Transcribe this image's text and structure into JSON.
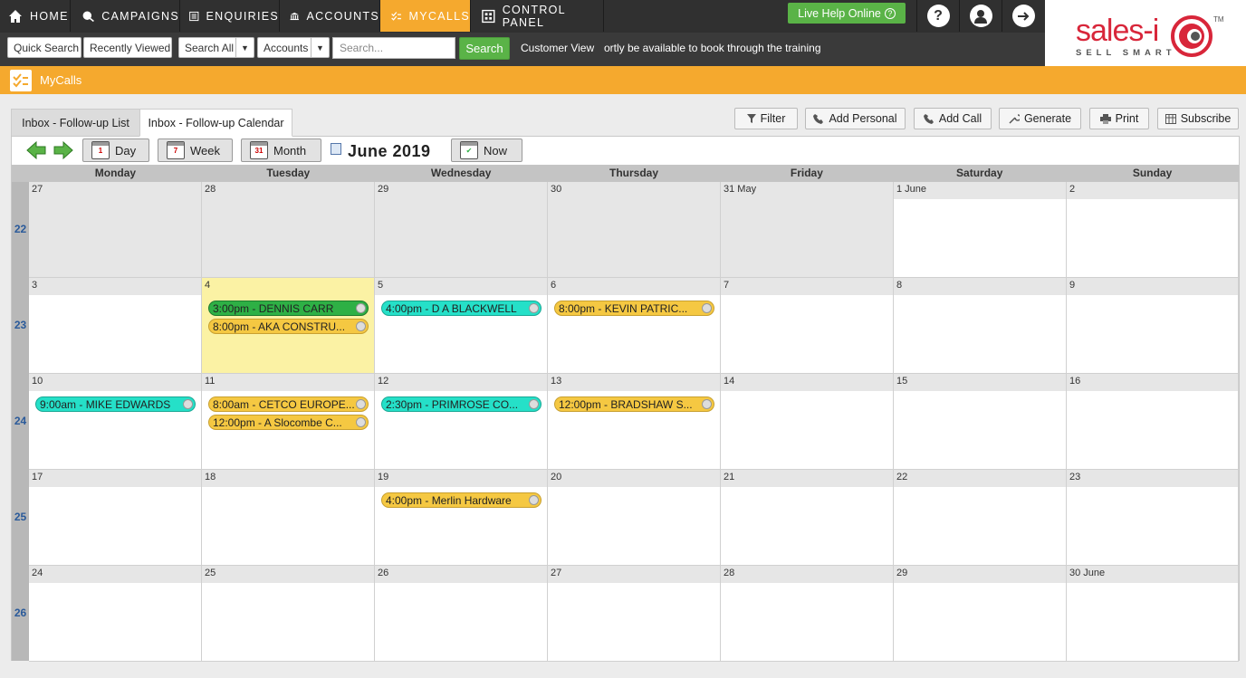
{
  "nav": {
    "items": [
      {
        "label": "HOME",
        "icon": "home-icon"
      },
      {
        "label": "CAMPAIGNS",
        "icon": "campaigns-icon"
      },
      {
        "label": "ENQUIRIES",
        "icon": "enquiries-icon"
      },
      {
        "label": "ACCOUNTS",
        "icon": "accounts-icon"
      },
      {
        "label": "MYCALLS",
        "icon": "mycalls-icon"
      },
      {
        "label": "CONTROL PANEL",
        "icon": "control-panel-icon"
      }
    ],
    "active": "MYCALLS",
    "live_help": "Live Help Online",
    "help_glyph": "?",
    "colors": {
      "bar": "#303030",
      "active": "#f5a92e",
      "live_help": "#5ab347"
    }
  },
  "subbar": {
    "quick_search": "Quick Search",
    "recently_viewed": "Recently Viewed",
    "search_all": "Search All",
    "accounts": "Accounts",
    "search_placeholder": "Search...",
    "search_button": "Search",
    "customer_view": "Customer View",
    "ticker": "ortly be available to book through the training t"
  },
  "logo": {
    "text": "sales-i",
    "tagline": "SELL SMART",
    "tm": "TM",
    "color": "#d8263a"
  },
  "page": {
    "title": "MyCalls"
  },
  "tabs": {
    "list": "Inbox - Follow-up List",
    "calendar": "Inbox - Follow-up Calendar"
  },
  "toolbar": {
    "filter": "Filter",
    "add_personal": "Add Personal",
    "add_call": "Add Call",
    "generate": "Generate",
    "print": "Print",
    "subscribe": "Subscribe"
  },
  "calendar": {
    "day": "Day",
    "week": "Week",
    "month": "Month",
    "now": "Now",
    "day_icon_num": "1",
    "week_icon_num": "7",
    "month_icon_num": "31",
    "title": "June 2019",
    "weekdays": [
      "Monday",
      "Tuesday",
      "Wednesday",
      "Thursday",
      "Friday",
      "Saturday",
      "Sunday"
    ],
    "weeks": [
      {
        "num": "22",
        "days": [
          "27",
          "28",
          "29",
          "30",
          "31 May",
          "1 June",
          "2"
        ]
      },
      {
        "num": "23",
        "days": [
          "3",
          "4",
          "5",
          "6",
          "7",
          "8",
          "9"
        ]
      },
      {
        "num": "24",
        "days": [
          "10",
          "11",
          "12",
          "13",
          "14",
          "15",
          "16"
        ]
      },
      {
        "num": "25",
        "days": [
          "17",
          "18",
          "19",
          "20",
          "21",
          "22",
          "23"
        ]
      },
      {
        "num": "26",
        "days": [
          "24",
          "25",
          "26",
          "27",
          "28",
          "29",
          "30 June"
        ]
      }
    ],
    "events": [
      {
        "week": 1,
        "day": 1,
        "slot": 0,
        "label": "3:00pm - DENNIS CARR",
        "color": "green"
      },
      {
        "week": 1,
        "day": 1,
        "slot": 1,
        "label": "8:00pm - AKA CONSTRU...",
        "color": "yellow"
      },
      {
        "week": 1,
        "day": 2,
        "slot": 0,
        "label": "4:00pm - D A BLACKWELL",
        "color": "teal"
      },
      {
        "week": 1,
        "day": 3,
        "slot": 0,
        "label": "8:00pm - KEVIN PATRIC...",
        "color": "yellow"
      },
      {
        "week": 2,
        "day": 0,
        "slot": 0,
        "label": "9:00am - MIKE EDWARDS",
        "color": "teal"
      },
      {
        "week": 2,
        "day": 1,
        "slot": 0,
        "label": "8:00am - CETCO EUROPE...",
        "color": "yellow"
      },
      {
        "week": 2,
        "day": 1,
        "slot": 1,
        "label": "12:00pm - A Slocombe C...",
        "color": "yellow"
      },
      {
        "week": 2,
        "day": 2,
        "slot": 0,
        "label": "2:30pm - PRIMROSE CO...",
        "color": "teal"
      },
      {
        "week": 2,
        "day": 3,
        "slot": 0,
        "label": "12:00pm - BRADSHAW S...",
        "color": "yellow"
      },
      {
        "week": 3,
        "day": 2,
        "slot": 0,
        "label": "4:00pm - Merlin Hardware",
        "color": "yellow"
      }
    ],
    "colors": {
      "yellow": "#f5c842",
      "teal": "#25e0c8",
      "green": "#2eb045",
      "today": "#fbf2a4"
    }
  }
}
